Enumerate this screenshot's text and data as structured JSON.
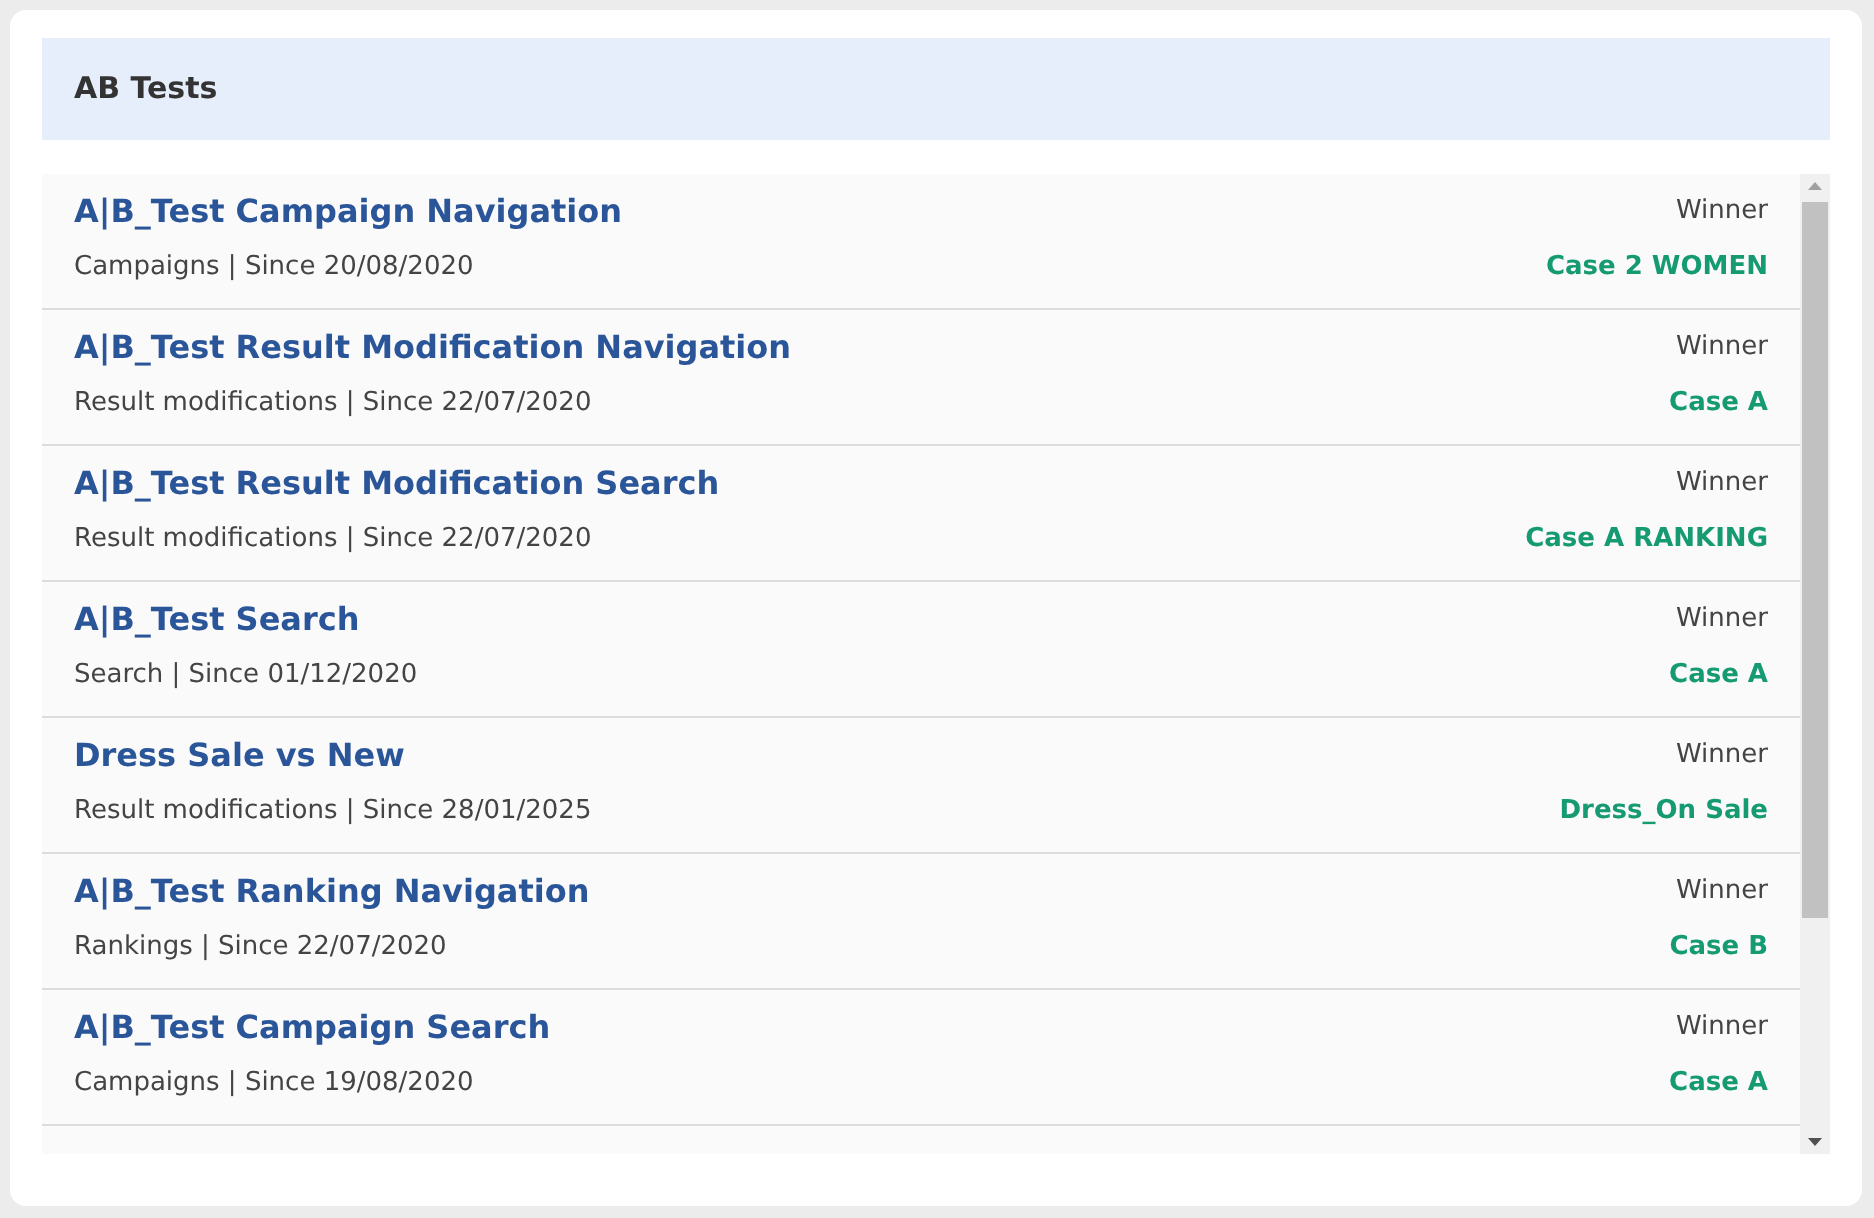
{
  "panel": {
    "title": "AB Tests"
  },
  "tests": [
    {
      "name": "A|B_Test Campaign Navigation",
      "subtitle": "Campaigns | Since 20/08/2020",
      "winner_label": "Winner",
      "winner": "Case 2 WOMEN"
    },
    {
      "name": "A|B_Test Result Modification Navigation",
      "subtitle": "Result modifications | Since 22/07/2020",
      "winner_label": "Winner",
      "winner": "Case A"
    },
    {
      "name": "A|B_Test Result Modification Search",
      "subtitle": "Result modifications | Since 22/07/2020",
      "winner_label": "Winner",
      "winner": "Case A RANKING"
    },
    {
      "name": "A|B_Test Search",
      "subtitle": "Search | Since 01/12/2020",
      "winner_label": "Winner",
      "winner": "Case A"
    },
    {
      "name": "Dress Sale vs New",
      "subtitle": "Result modifications | Since 28/01/2025",
      "winner_label": "Winner",
      "winner": "Dress_On Sale"
    },
    {
      "name": "A|B_Test Ranking Navigation",
      "subtitle": "Rankings | Since 22/07/2020",
      "winner_label": "Winner",
      "winner": "Case B"
    },
    {
      "name": "A|B_Test Campaign Search",
      "subtitle": "Campaigns | Since 19/08/2020",
      "winner_label": "Winner",
      "winner": "Case A"
    }
  ]
}
